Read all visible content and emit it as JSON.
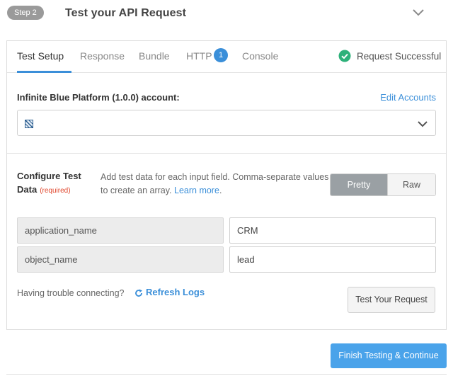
{
  "step": {
    "badge": "Step 2",
    "title": "Test your API Request",
    "collapse_icon": "chevron-down-icon"
  },
  "tabs": [
    {
      "label": "Test Setup",
      "active": true
    },
    {
      "label": "Response",
      "active": false
    },
    {
      "label": "Bundle",
      "active": false
    },
    {
      "label": "HTTP",
      "active": false,
      "badge": "1"
    },
    {
      "label": "Console",
      "active": false
    }
  ],
  "status": {
    "text": "Request Successful",
    "icon": "check-circle-icon",
    "color": "#2db17a"
  },
  "account": {
    "label": "Infinite Blue Platform (1.0.0) account:",
    "edit_label": "Edit Accounts",
    "selected_icon": "account-logo-icon"
  },
  "configure": {
    "title": "Configure Test Data",
    "required": "(required)",
    "description": "Add test data for each input field. Comma-separate values to create an array. ",
    "learn_more": "Learn more",
    "learn_more_suffix": ".",
    "format_options": [
      "Pretty",
      "Raw"
    ],
    "selected_format": "Pretty"
  },
  "fields": [
    {
      "key": "application_name",
      "value": "CRM"
    },
    {
      "key": "object_name",
      "value": "lead"
    }
  ],
  "footer": {
    "trouble_text": "Having trouble connecting?",
    "refresh_label": "Refresh Logs",
    "test_button": "Test Your Request",
    "finish_button": "Finish Testing & Continue"
  },
  "colors": {
    "accent": "#3b8fd9",
    "primary_button": "#4aa3ea",
    "required": "#e0462c"
  }
}
